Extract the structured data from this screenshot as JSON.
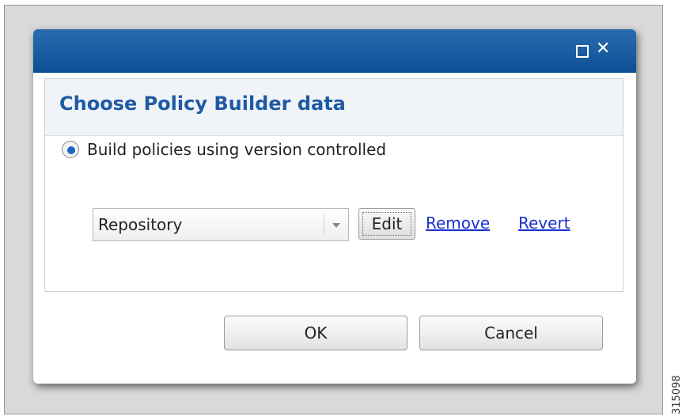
{
  "dialog": {
    "title": "Choose Policy Builder data",
    "radio_label": "Build policies using version controlled",
    "radio_selected": true,
    "repository_select": {
      "value": "Repository"
    },
    "edit_label": "Edit",
    "remove_label": "Remove",
    "revert_label": "Revert",
    "ok_label": "OK",
    "cancel_label": "Cancel",
    "icons": {
      "maximize": "maximize-icon",
      "close": "close-icon",
      "dropdown": "chevron-down-icon"
    },
    "colors": {
      "titlebar": "#0c4f95",
      "title_text": "#1e5aa3",
      "link": "#1a33cc",
      "radio_dot": "#1d64c8"
    }
  },
  "figure_number": "315098"
}
